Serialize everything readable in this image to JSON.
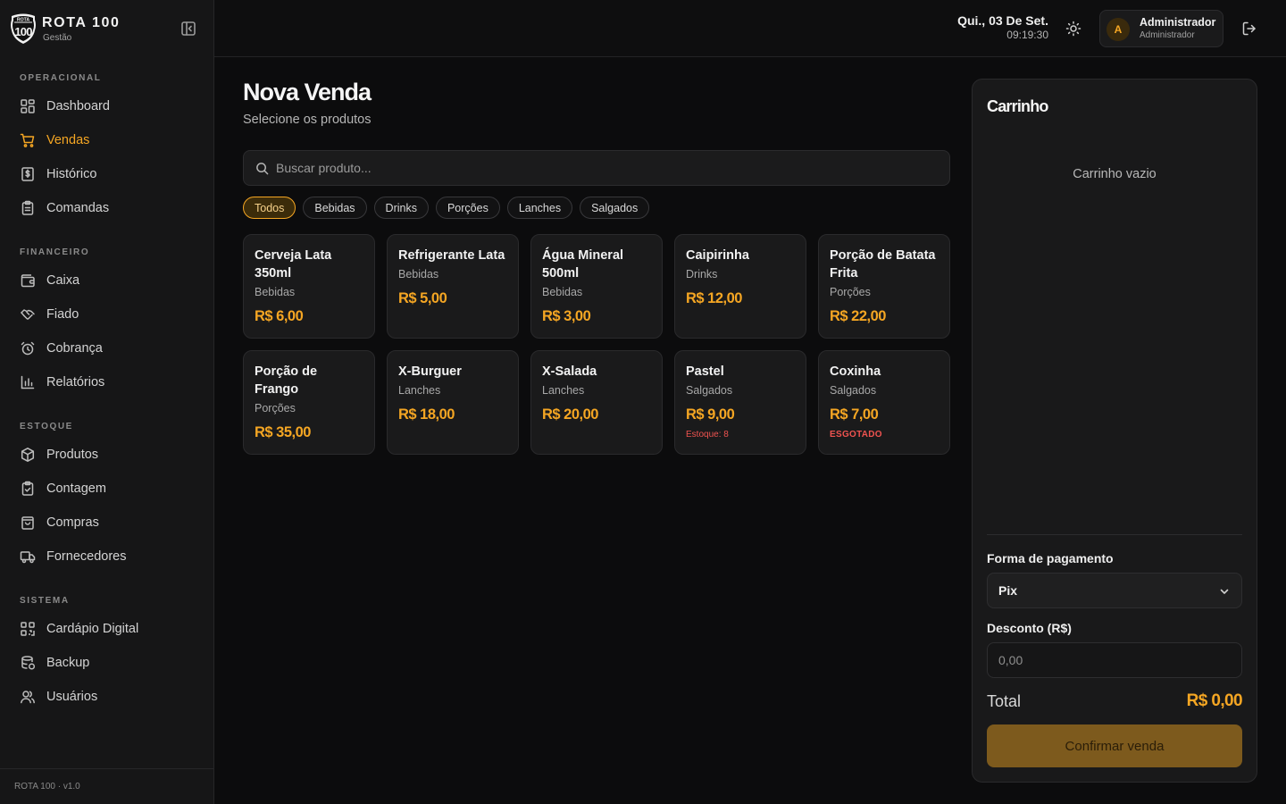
{
  "brand": {
    "title": "ROTA 100",
    "subtitle": "Gestão",
    "logo_top": "ROTA",
    "logo_num": "100"
  },
  "sidebar": {
    "sections": [
      {
        "title": "OPERACIONAL",
        "items": [
          {
            "label": "Dashboard",
            "icon": "dashboard-icon"
          },
          {
            "label": "Vendas",
            "icon": "cart-icon",
            "active": true
          },
          {
            "label": "Histórico",
            "icon": "receipt-icon"
          },
          {
            "label": "Comandas",
            "icon": "clipboard-icon"
          }
        ]
      },
      {
        "title": "FINANCEIRO",
        "items": [
          {
            "label": "Caixa",
            "icon": "wallet-icon"
          },
          {
            "label": "Fiado",
            "icon": "handshake-icon"
          },
          {
            "label": "Cobrança",
            "icon": "alarm-clock-icon"
          },
          {
            "label": "Relatórios",
            "icon": "bar-chart-icon"
          }
        ]
      },
      {
        "title": "ESTOQUE",
        "items": [
          {
            "label": "Produtos",
            "icon": "package-icon"
          },
          {
            "label": "Contagem",
            "icon": "clipboard-check-icon"
          },
          {
            "label": "Compras",
            "icon": "shopping-bag-icon"
          },
          {
            "label": "Fornecedores",
            "icon": "truck-icon"
          }
        ]
      },
      {
        "title": "SISTEMA",
        "items": [
          {
            "label": "Cardápio Digital",
            "icon": "qr-code-icon"
          },
          {
            "label": "Backup",
            "icon": "database-icon"
          },
          {
            "label": "Usuários",
            "icon": "users-icon"
          }
        ]
      }
    ],
    "footer": "ROTA 100 · v1.0"
  },
  "topbar": {
    "date": "Qui., 03 De Set.",
    "time": "09:19:30",
    "user": {
      "initial": "A",
      "name": "Administrador",
      "role": "Administrador"
    }
  },
  "main": {
    "title": "Nova Venda",
    "subtitle": "Selecione os produtos",
    "search_placeholder": "Buscar produto...",
    "categories": [
      "Todos",
      "Bebidas",
      "Drinks",
      "Porções",
      "Lanches",
      "Salgados"
    ],
    "active_category": "Todos",
    "products": [
      {
        "name": "Cerveja Lata 350ml",
        "category": "Bebidas",
        "price": "R$ 6,00",
        "stock": ""
      },
      {
        "name": "Refrigerante Lata",
        "category": "Bebidas",
        "price": "R$ 5,00",
        "stock": ""
      },
      {
        "name": "Água Mineral 500ml",
        "category": "Bebidas",
        "price": "R$ 3,00",
        "stock": ""
      },
      {
        "name": "Caipirinha",
        "category": "Drinks",
        "price": "R$ 12,00",
        "stock": ""
      },
      {
        "name": "Porção de Batata Frita",
        "category": "Porções",
        "price": "R$ 22,00",
        "stock": ""
      },
      {
        "name": "Porção de Frango",
        "category": "Porções",
        "price": "R$ 35,00",
        "stock": ""
      },
      {
        "name": "X-Burguer",
        "category": "Lanches",
        "price": "R$ 18,00",
        "stock": ""
      },
      {
        "name": "X-Salada",
        "category": "Lanches",
        "price": "R$ 20,00",
        "stock": ""
      },
      {
        "name": "Pastel",
        "category": "Salgados",
        "price": "R$ 9,00",
        "stock": "Estoque: 8"
      },
      {
        "name": "Coxinha",
        "category": "Salgados",
        "price": "R$ 7,00",
        "stock": "ESGOTADO"
      }
    ]
  },
  "cart": {
    "title": "Carrinho",
    "empty_text": "Carrinho vazio",
    "payment_label": "Forma de pagamento",
    "payment_value": "Pix",
    "discount_label": "Desconto (R$)",
    "discount_placeholder": "0,00",
    "total_label": "Total",
    "total_value": "R$ 0,00",
    "confirm_label": "Confirmar venda"
  },
  "colors": {
    "accent": "#f5a623",
    "danger": "#ef5350",
    "background": "#0c0c0d",
    "sidebar": "#161617"
  }
}
